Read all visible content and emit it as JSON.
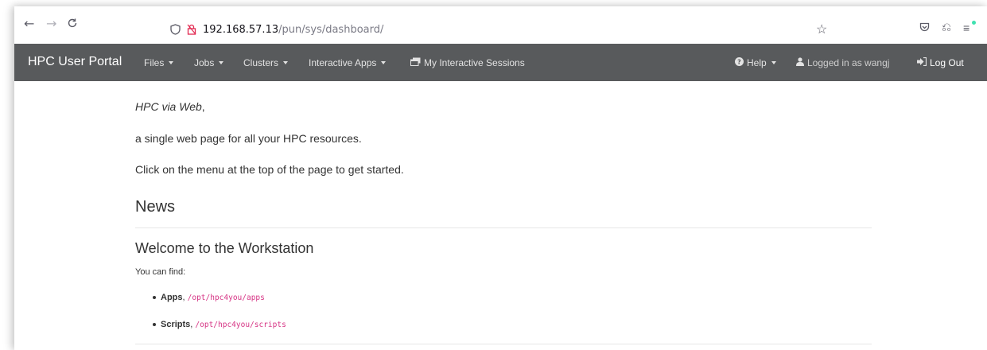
{
  "browser": {
    "url_host": "192.168.57.13",
    "url_path": "/pun/sys/dashboard/",
    "icons": [
      "back-arrow-icon",
      "forward-arrow-icon",
      "reload-icon",
      "shield-icon",
      "lock-icon",
      "star-icon",
      "pocket-icon",
      "extensions-icon",
      "menu-icon"
    ]
  },
  "navbar": {
    "brand": "HPC User Portal",
    "items": [
      {
        "label": "Files",
        "dropdown": true
      },
      {
        "label": "Jobs",
        "dropdown": true
      },
      {
        "label": "Clusters",
        "dropdown": true
      },
      {
        "label": "Interactive Apps",
        "dropdown": true
      },
      {
        "label": "My Interactive Sessions",
        "icon": "sessions-icon"
      }
    ],
    "right": {
      "help": "Help",
      "logged_in": "Logged in as wangj",
      "logout": "Log Out"
    },
    "background": "#585a5c"
  },
  "main": {
    "tagline_italic": "HPC via Web",
    "tagline_suffix": ",",
    "line2": "a single web page for all your HPC resources.",
    "line3": "Click on the menu at the top of the page to get started.",
    "news_title": "News",
    "post": {
      "title": "Welcome to the Workstation",
      "intro": "You can find:",
      "items": [
        {
          "label": "Apps",
          "sep": ", ",
          "path": "/opt/hpc4you/apps"
        },
        {
          "label": "Scripts",
          "sep": ", ",
          "path": "/opt/hpc4you/scripts"
        }
      ]
    }
  }
}
